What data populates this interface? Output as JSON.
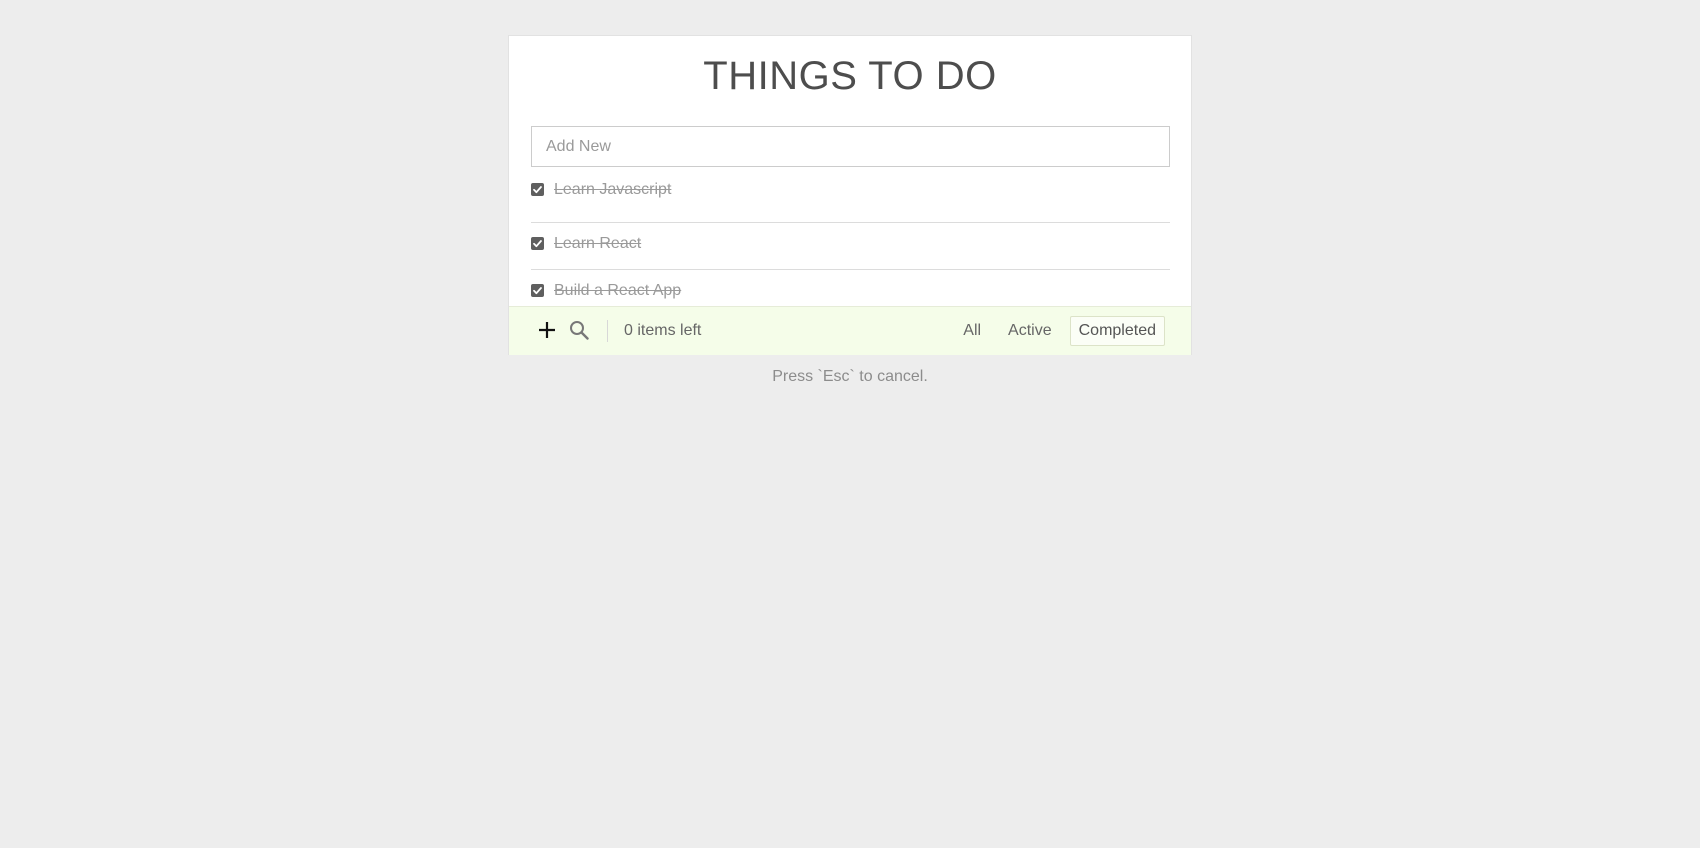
{
  "title": "THINGS TO DO",
  "add_input": {
    "placeholder": "Add New",
    "value": ""
  },
  "todos": [
    {
      "text": "Learn Javascript",
      "completed": true
    },
    {
      "text": "Learn React",
      "completed": true
    },
    {
      "text": "Build a React App",
      "completed": true
    }
  ],
  "footer": {
    "items_left": "0 items left",
    "filters": {
      "all": "All",
      "active": "Active",
      "completed": "Completed"
    },
    "selected_filter": "completed",
    "icons": [
      "plus-icon",
      "search-icon"
    ]
  },
  "hint": "Press `Esc` to cancel.",
  "colors": {
    "background": "#ededed",
    "card": "#ffffff",
    "footer_background": "#f5fde9",
    "title_text": "#4d4d4d",
    "completed_text": "#9a9a9a",
    "checkbox": "#5f5f5f"
  }
}
